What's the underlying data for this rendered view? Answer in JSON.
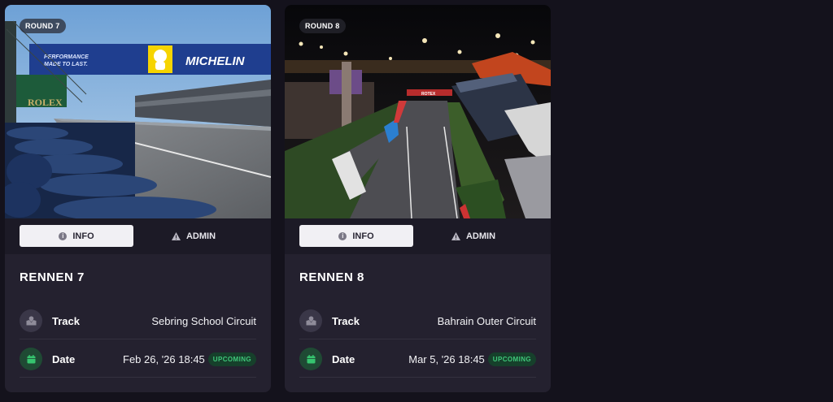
{
  "tabs": {
    "info_label": "INFO",
    "admin_label": "ADMIN"
  },
  "row_labels": {
    "track": "Track",
    "date": "Date"
  },
  "cards": [
    {
      "round": "ROUND 7",
      "title": "RENNEN 7",
      "track": "Sebring School Circuit",
      "date": "Feb 26, '26 18:45",
      "status": "UPCOMING",
      "image": {
        "banner_tagline_1": "PERFORMANCE",
        "banner_tagline_2": "MADE TO LAST.",
        "banner_brand": "MICHELIN",
        "side_brand": "ROLEX"
      }
    },
    {
      "round": "ROUND 8",
      "title": "RENNEN 8",
      "track": "Bahrain Outer Circuit",
      "date": "Mar 5, '26 18:45",
      "status": "UPCOMING",
      "image": {
        "gantry_text": "ROTEX"
      }
    }
  ],
  "colors": {
    "background": "#14121c",
    "card": "#24212f",
    "status_green": "#3fc77a"
  }
}
